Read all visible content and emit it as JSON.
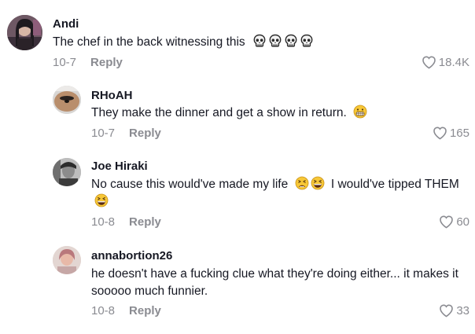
{
  "comments": [
    {
      "username": "Andi",
      "text": "The chef in the back witnessing this",
      "emojis": [
        "skull",
        "skull",
        "skull",
        "skull"
      ],
      "date": "10-7",
      "reply_label": "Reply",
      "likes": "18.4K"
    },
    {
      "username": "RHoAH",
      "text": "They make the dinner and get a show in return.",
      "emojis": [
        "grimacing"
      ],
      "date": "10-7",
      "reply_label": "Reply",
      "likes": "165"
    },
    {
      "username": "Joe Hiraki",
      "text_a": "No cause this would've made my life",
      "text_b": "I would've tipped THEM",
      "emojis": [
        "tired",
        "grinning-squint",
        "grinning-squint"
      ],
      "date": "10-8",
      "reply_label": "Reply",
      "likes": "60"
    },
    {
      "username": "annabortion26",
      "text": "he doesn't have a fucking clue what they're doing either... it makes it sooooo much funnier.",
      "date": "10-8",
      "reply_label": "Reply",
      "likes": "33"
    }
  ]
}
